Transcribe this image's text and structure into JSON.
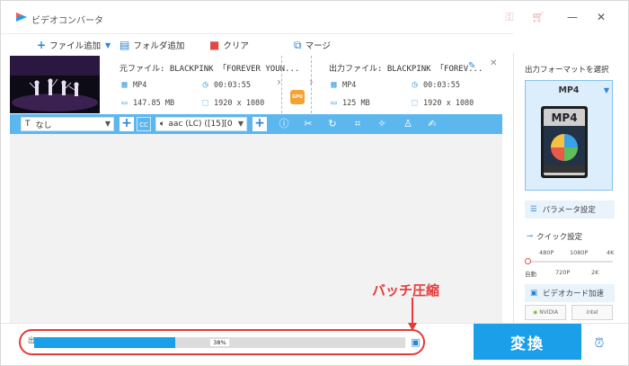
{
  "app": {
    "title": "ビデオコンバータ"
  },
  "toolbar": {
    "add_file": "ファイル追加",
    "add_folder": "フォルダ追加",
    "clear": "クリア",
    "merge": "マージ"
  },
  "file": {
    "source_name": "元ファイル: BLACKPINK 「FOREVER YOUN...",
    "source_format": "MP4",
    "source_duration": "00:03:55",
    "source_size": "147.85 MB",
    "source_resolution": "1920 x 1080",
    "gpu_label": "GPU",
    "output_name": "出力ファイル: BLACKPINK 「FOREV...",
    "output_format": "MP4",
    "output_duration": "00:03:55",
    "output_size": "125 MB",
    "output_resolution": "1920 x 1080"
  },
  "editbar": {
    "subtitle_select": "なし",
    "cc_label": "CC",
    "audio_select": "aac (LC) ([15][0"
  },
  "right_panel": {
    "title": "出力フォーマットを選択",
    "format": "MP4",
    "format_art_label": "MP4",
    "parameter_button": "パラメータ設定",
    "quick_title": "クイック設定",
    "quick_labels_top": [
      "480P",
      "1080P",
      "4K"
    ],
    "quick_labels_bottom": [
      "自動",
      "720P",
      "2K"
    ],
    "gpu_accel": "ビデオカード加速",
    "vendor_nvidia": "NVIDIA",
    "vendor_intel": "intel"
  },
  "bottom": {
    "output_label": "出",
    "progress_percent": 38,
    "progress_text": "38%",
    "convert_button": "変換"
  },
  "annotation": {
    "label": "バッチ圧縮"
  },
  "colors": {
    "accent": "#1a9fe8",
    "editbar": "#5db7ef",
    "annotation": "#e43a3a",
    "gpu_chip": "#f3a233"
  }
}
